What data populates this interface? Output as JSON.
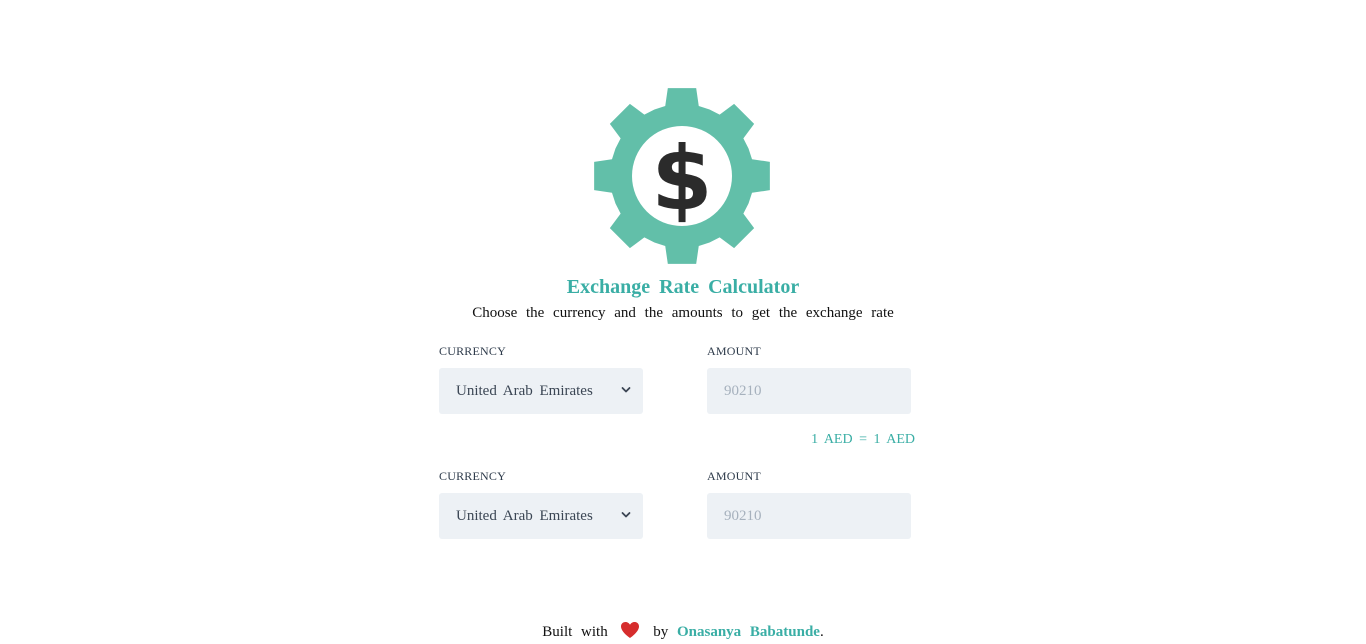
{
  "header": {
    "logo_icon": "gear-dollar-icon",
    "title": "Exchange Rate Calculator",
    "subtitle": "Choose the currency and the amounts to get the exchange rate"
  },
  "colors": {
    "accent": "#3aaea5",
    "gear": "#62bfa9",
    "dollar": "#2b2b2b",
    "field_bg": "#edf1f5"
  },
  "converter": {
    "from": {
      "currency_label": "CURRENCY",
      "currency_value": "United Arab Emirates",
      "amount_label": "AMOUNT",
      "amount_placeholder": "90210"
    },
    "rate_text": "1 AED = 1 AED",
    "to": {
      "currency_label": "CURRENCY",
      "currency_value": "United Arab Emirates",
      "amount_label": "AMOUNT",
      "amount_placeholder": "90210"
    }
  },
  "footer": {
    "built_with": "Built with",
    "heart_icon": "heart-icon",
    "by": "by",
    "author": "Onasanya Babatunde",
    "period": "."
  }
}
